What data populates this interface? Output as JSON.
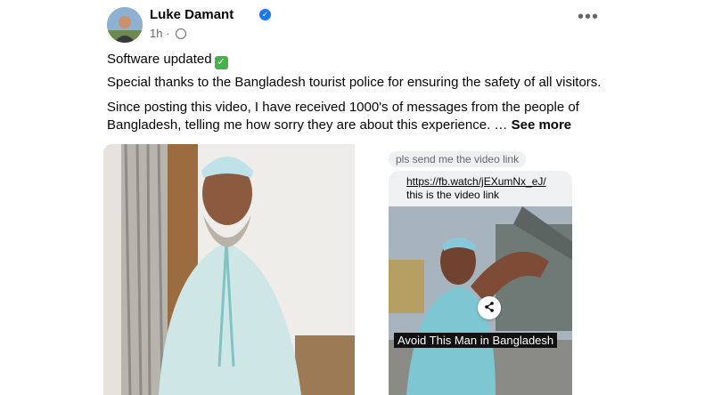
{
  "post": {
    "author": "Luke Damant",
    "time": "1h",
    "line1": "Software updated",
    "line2": "Special thanks to the Bangladesh tourist police for ensuring the safety of all visitors.",
    "line3": "Since posting this video, I have received 1000's of messages from the people of Bangladesh, telling me how sorry they are about this experience. …",
    "see_more": "See more",
    "more_options": "•••"
  },
  "media": {
    "chat_request": "pls send me the video link",
    "chat_link": "https://fb.watch/jEXumNx_eJ/",
    "chat_reply": "this is the video link",
    "video_caption": "Avoid This Man in Bangladesh"
  },
  "icons": {
    "verified": "verified-badge-icon",
    "globe": "globe-icon",
    "share": "share-icon",
    "check": "check-emoji-icon"
  },
  "colors": {
    "verified": "#1877f2",
    "secondary_text": "#65676b"
  }
}
